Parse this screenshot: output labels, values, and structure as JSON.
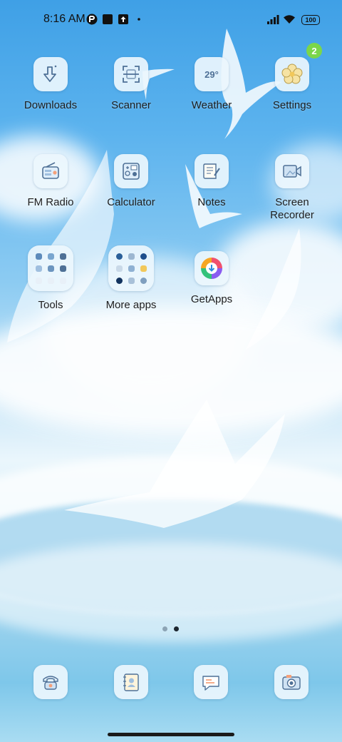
{
  "status_bar": {
    "time": "8:16 AM",
    "battery": "100",
    "icons": [
      "app-notification-icon",
      "square-notification-icon",
      "upload-notification-icon",
      "dot-icon",
      "signal-icon",
      "wifi-icon",
      "battery-icon"
    ]
  },
  "apps": [
    {
      "label": "Downloads",
      "icon": "download-icon"
    },
    {
      "label": "Scanner",
      "icon": "scanner-icon"
    },
    {
      "label": "Weather",
      "icon": "weather-icon",
      "value": "29°"
    },
    {
      "label": "Settings",
      "icon": "settings-icon",
      "badge": "2"
    },
    {
      "label": "FM Radio",
      "icon": "radio-icon"
    },
    {
      "label": "Calculator",
      "icon": "calculator-icon"
    },
    {
      "label": "Notes",
      "icon": "notes-icon"
    },
    {
      "label": "Screen\nRecorder",
      "icon": "screen-recorder-icon"
    },
    {
      "label": "Tools",
      "icon": "folder-icon"
    },
    {
      "label": "More apps",
      "icon": "folder-icon"
    },
    {
      "label": "GetApps",
      "icon": "getapps-icon"
    }
  ],
  "page_indicator": {
    "pages": 2,
    "current": 2
  },
  "dock": [
    {
      "icon": "phone-icon"
    },
    {
      "icon": "contacts-icon"
    },
    {
      "icon": "messages-icon"
    },
    {
      "icon": "camera-icon"
    }
  ],
  "colors": {
    "sky_top": "#3fa0e6",
    "sea": "#7ec7ea",
    "badge": "#7bd64a",
    "icon_tile": "#ecf6fd",
    "icon_line": "#5a7fa6"
  }
}
